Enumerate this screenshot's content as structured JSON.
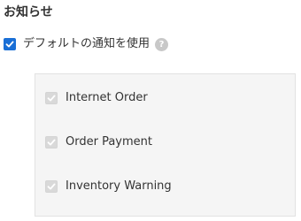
{
  "section": {
    "title": "お知らせ"
  },
  "main_option": {
    "label": "デフォルトの通知を使用",
    "checked": true,
    "help_icon": "question-circle-icon",
    "help_glyph": "?"
  },
  "sub_options": [
    {
      "label": "Internet Order",
      "checked": true,
      "disabled": true
    },
    {
      "label": "Order Payment",
      "checked": true,
      "disabled": true
    },
    {
      "label": "Inventory Warning",
      "checked": true,
      "disabled": true
    }
  ],
  "colors": {
    "accent": "#1a6fd6",
    "disabled_check": "#d9d9d9",
    "panel_bg": "#f5f5f5",
    "panel_border": "#e2e2e2",
    "text": "#333333",
    "help_icon_bg": "#c8c8c8"
  }
}
